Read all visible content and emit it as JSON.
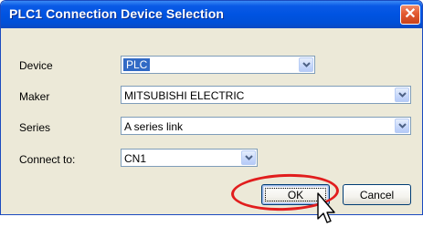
{
  "dialog": {
    "title": "PLC1 Connection Device Selection",
    "close_symbol": "✕"
  },
  "fields": {
    "device": {
      "label": "Device",
      "value": "PLC"
    },
    "maker": {
      "label": "Maker",
      "value": "MITSUBISHI ELECTRIC"
    },
    "series": {
      "label": "Series",
      "value": "A series link"
    },
    "connect_to": {
      "label": "Connect to:",
      "value": "CN1"
    }
  },
  "buttons": {
    "ok": "OK",
    "cancel": "Cancel"
  },
  "icons": {
    "dropdown": "chevron-down-icon",
    "cursor": "mouse-pointer-icon"
  },
  "colors": {
    "titlebar": "#0053e1",
    "highlight": "#e11d1d",
    "selection": "#316ac5"
  }
}
